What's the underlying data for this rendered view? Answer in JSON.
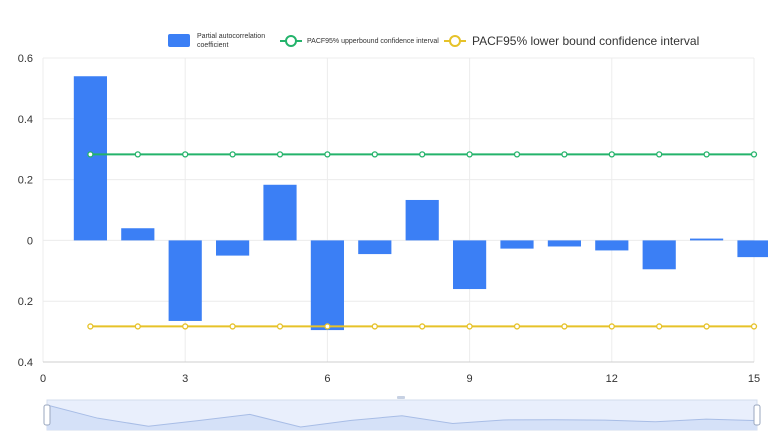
{
  "chart_data": {
    "type": "bar",
    "xlim": [
      0,
      15
    ],
    "ylim": [
      -0.4,
      0.6
    ],
    "x_ticks": [
      0,
      3,
      6,
      9,
      12,
      15
    ],
    "x_tick_labels": [
      "0",
      "3",
      "6",
      "9",
      "12",
      "15"
    ],
    "y_ticks": [
      0.6,
      0.4,
      0.2,
      0,
      -0.2,
      -0.4
    ],
    "y_tick_labels": [
      "0.6",
      "0.4",
      "0.2",
      "0",
      "0.2",
      "0.4"
    ],
    "grid": true,
    "legend_position": "top",
    "data_zoom_slider": true,
    "series": [
      {
        "name": "Partial autocorrelation coefficient",
        "type": "bar",
        "color": "#3b7ff5",
        "x": [
          1,
          2,
          3,
          4,
          5,
          6,
          7,
          8,
          9,
          10,
          11,
          12,
          13,
          14,
          15
        ],
        "values": [
          0.54,
          0.04,
          -0.265,
          -0.05,
          0.183,
          -0.295,
          -0.045,
          0.133,
          -0.16,
          -0.027,
          -0.02,
          -0.033,
          -0.095,
          0.006,
          -0.055
        ]
      },
      {
        "name": "PACF95% upperbound confidence interval",
        "type": "line",
        "color": "#24b36b",
        "x": [
          1,
          2,
          3,
          4,
          5,
          6,
          7,
          8,
          9,
          10,
          11,
          12,
          13,
          14,
          15
        ],
        "values": [
          0.283,
          0.283,
          0.283,
          0.283,
          0.283,
          0.283,
          0.283,
          0.283,
          0.283,
          0.283,
          0.283,
          0.283,
          0.283,
          0.283,
          0.283
        ]
      },
      {
        "name": "PACF95% lower bound confidence interval",
        "type": "line",
        "color": "#e6c229",
        "x": [
          1,
          2,
          3,
          4,
          5,
          6,
          7,
          8,
          9,
          10,
          11,
          12,
          13,
          14,
          15
        ],
        "values": [
          -0.283,
          -0.283,
          -0.283,
          -0.283,
          -0.283,
          -0.283,
          -0.283,
          -0.283,
          -0.283,
          -0.283,
          -0.283,
          -0.283,
          -0.283,
          -0.283,
          -0.283
        ]
      }
    ]
  }
}
